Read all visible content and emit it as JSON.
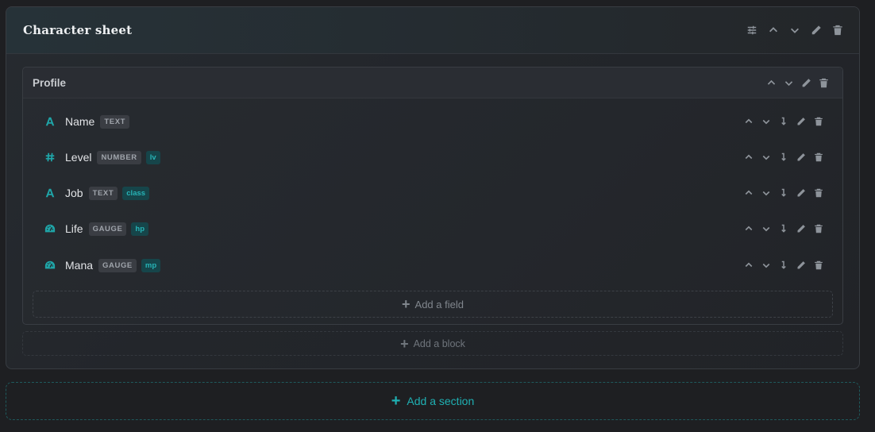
{
  "section": {
    "title": "Character sheet",
    "icons": [
      "sliders-icon",
      "chevron-up-icon",
      "chevron-down-icon",
      "pencil-icon",
      "trash-icon"
    ]
  },
  "block": {
    "title": "Profile",
    "fields": [
      {
        "name": "Name",
        "type": "TEXT",
        "alias": "",
        "icon": "text-icon"
      },
      {
        "name": "Level",
        "type": "NUMBER",
        "alias": "lv",
        "icon": "hash-icon"
      },
      {
        "name": "Job",
        "type": "TEXT",
        "alias": "class",
        "icon": "text-icon"
      },
      {
        "name": "Life",
        "type": "GAUGE",
        "alias": "hp",
        "icon": "gauge-icon"
      },
      {
        "name": "Mana",
        "type": "GAUGE",
        "alias": "mp",
        "icon": "gauge-icon"
      }
    ],
    "add_field_label": "Add a field"
  },
  "add_block_label": "Add a block",
  "add_section_label": "Add a section",
  "colors": {
    "accent": "#1fa5a8",
    "background": "#1e1f22",
    "icon_muted": "#8e949b"
  }
}
